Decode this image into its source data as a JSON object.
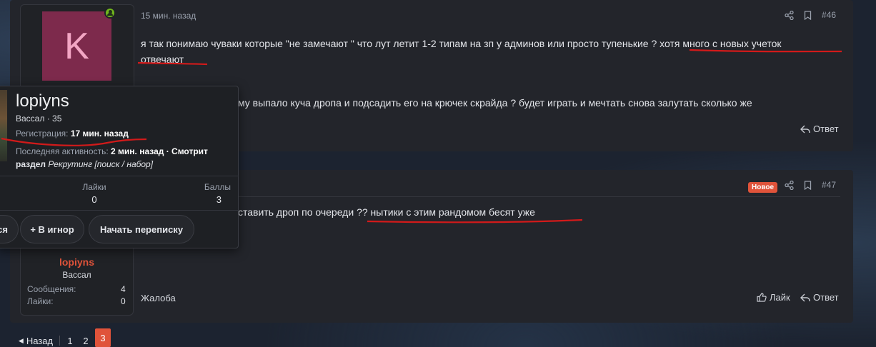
{
  "post1": {
    "avatar_letter": "K",
    "time": "15 мин. назад",
    "number": "#46",
    "text_line1": "я так понимаю чуваки которые \"не замечают \" что лут летит 1-2 типам на зп у админов или просто тупенькие ? хотя много с новых учеток",
    "text_line2": "отвечают",
    "text_line3_fragment": "му выпало куча дропа и подсадить его на крючек скрайда ? будет играть и мечтать снова залутать сколько же",
    "reply_label": "Ответ"
  },
  "post2": {
    "badge": "Новое",
    "number": "#47",
    "text_fragment": "ставить дроп по очереди ?? нытики с этим рандомом бесят уже",
    "report_label": "Жалоба",
    "like_label": "Лайк",
    "reply_label": "Ответ",
    "user": {
      "name": "lopiyns",
      "title": "Вассал",
      "stats": [
        {
          "label": "Сообщения:",
          "value": "4"
        },
        {
          "label": "Лайки:",
          "value": "0"
        }
      ]
    }
  },
  "tooltip": {
    "name": "lopiyns",
    "rank_line": "Вассал · 35",
    "registration_label": "Регистрация:",
    "registration_value": "17 мин. назад",
    "activity_label": "Последняя активность:",
    "activity_value": "2 мин. назад",
    "activity_suffix": "· Смотрит",
    "activity_line2_prefix": "раздел",
    "activity_line2_section": "Рекрутинг [поиск / набор]",
    "stats": [
      {
        "label": "Лайки",
        "value": "0"
      },
      {
        "label": "Баллы",
        "value": "3"
      }
    ],
    "buttons": {
      "follow_partial": "ся",
      "ignore": "+ В игнор",
      "message": "Начать переписку"
    }
  },
  "pagination": {
    "prev": "Назад",
    "pages": [
      "1",
      "2",
      "3"
    ],
    "current": "3"
  },
  "colors": {
    "accent_orange": "#e0533a",
    "underline_red": "#d21a1a",
    "avatar_bg": "#7d2a4c",
    "online_green": "#71b71c"
  }
}
